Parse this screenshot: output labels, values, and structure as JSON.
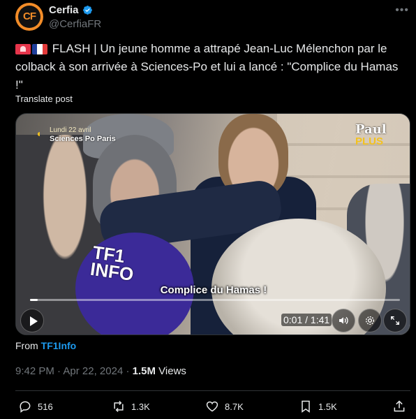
{
  "author": {
    "name": "Cerfia",
    "handle": "@CerfiaFR",
    "avatar_text": "CF",
    "more_label": "•••"
  },
  "tweet": {
    "emojis": [
      "rotating-light-emoji",
      "france-flag-emoji"
    ],
    "text": "FLASH | Un jeune homme a attrapé Jean-Luc Mélenchon par le colback à son arrivée à Sciences-Po et lui a lancé : \"Complice du Hamas !\"",
    "translate_label": "Translate post"
  },
  "video": {
    "overlay_date": "Lundi 22 avril",
    "overlay_place": "Sciences Po Paris",
    "brand_top": "Paul",
    "brand_bottom": "PLUS",
    "mic_label_line1": "TF1",
    "mic_label_line2": "INFO",
    "subtitle": "Complice du Hamas !",
    "time_display": "0:01 / 1:41",
    "progress_fraction": 0.01
  },
  "source": {
    "prefix": "From",
    "name": "TF1Info"
  },
  "meta": {
    "time": "9:42 PM",
    "separator": "·",
    "date": "Apr 22, 2024",
    "views_count": "1.5M",
    "views_label": "Views"
  },
  "actions": {
    "replies": "516",
    "reposts": "1.3K",
    "likes": "8.7K",
    "bookmarks": "1.5K"
  },
  "colors": {
    "background": "#000000",
    "text": "#e7e9ea",
    "muted": "#71767b",
    "accent": "#1d9bf0",
    "verified": "#1d9bf0",
    "brand_orange": "#f28c28"
  }
}
